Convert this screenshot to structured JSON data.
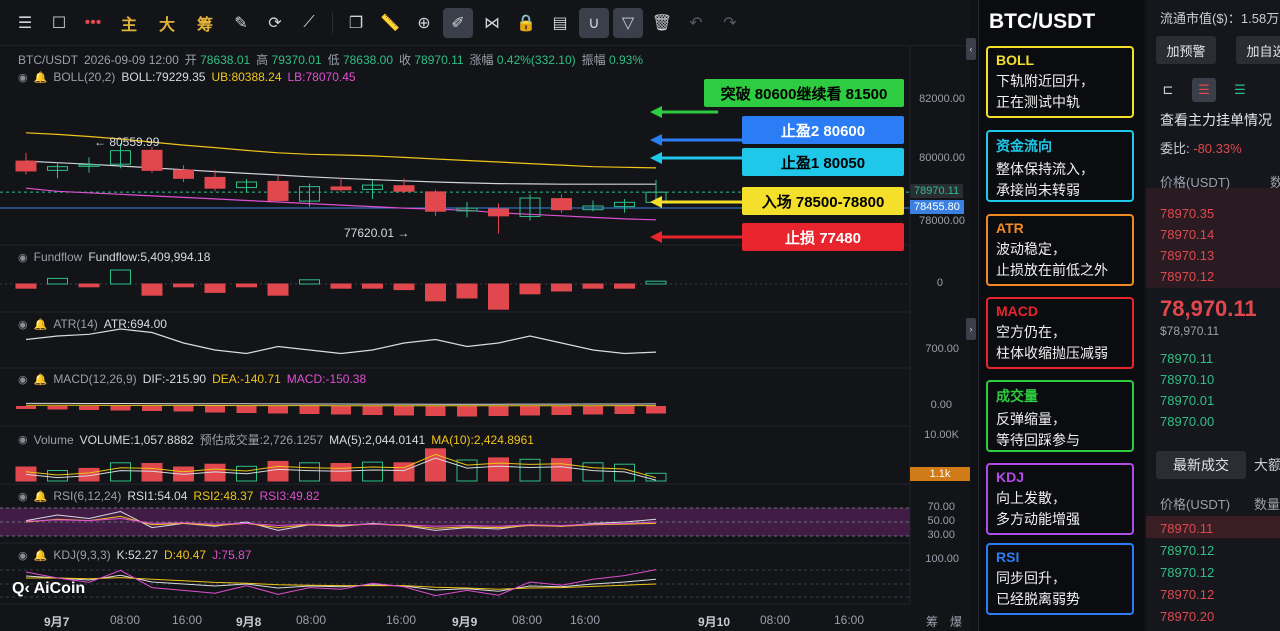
{
  "toolbar": {
    "text_buttons": [
      "主",
      "大",
      "筹"
    ]
  },
  "header": {
    "symbol": "BTC/USDT",
    "datetime": "2026-09-09 12:00",
    "open_label": "开",
    "open": "78638.01",
    "high_label": "高",
    "high": "79370.01",
    "low_label": "低",
    "low": "78638.00",
    "close_label": "收",
    "close": "78970.11",
    "change_label": "涨幅",
    "change": "0.42%(332.10)",
    "amp_label": "振幅",
    "amp": "0.93%"
  },
  "indicators": {
    "boll": {
      "name": "BOLL(20,2)",
      "mid": "BOLL:79229.35",
      "ub": "UB:80388.24",
      "lb": "LB:78070.45"
    },
    "fundflow": {
      "name": "Fundflow",
      "value": "Fundflow:5,409,994.18"
    },
    "atr": {
      "name": "ATR(14)",
      "value": "ATR:694.00"
    },
    "macd": {
      "name": "MACD(12,26,9)",
      "dif": "DIF:-215.90",
      "dea": "DEA:-140.71",
      "macd": "MACD:-150.38"
    },
    "volume": {
      "name": "Volume",
      "vol": "VOLUME:1,057.8882",
      "est": "预估成交量:2,726.1257",
      "ma5": "MA(5):2,044.0141",
      "ma10": "MA(10):2,424.8961"
    },
    "rsi": {
      "name": "RSI(6,12,24)",
      "rsi1": "RSI1:54.04",
      "rsi2": "RSI2:48.37",
      "rsi3": "RSI3:49.82"
    },
    "kdj": {
      "name": "KDJ(9,3,3)",
      "k": "K:52.27",
      "d": "D:40.47",
      "j": "J:75.87"
    }
  },
  "yaxis": {
    "price": [
      "82000.00",
      "80000.00",
      "78000.00"
    ],
    "fundflow": [
      "0"
    ],
    "atr": [
      "700.00"
    ],
    "macd": [
      "0.00"
    ],
    "volume": [
      "10.00K"
    ],
    "rsi": [
      "70.00",
      "50.00",
      "30.00"
    ],
    "kdj": [
      "100.00"
    ]
  },
  "price_tags": {
    "last": "78970.11",
    "line": "78455.80",
    "volume": "1.1k"
  },
  "chart_marks": {
    "high_mark": "← 80559.99",
    "low_mark": "77620.01 →"
  },
  "xaxis": [
    {
      "label": "9月7",
      "bold": true
    },
    {
      "label": "08:00",
      "bold": false
    },
    {
      "label": "16:00",
      "bold": false
    },
    {
      "label": "9月8",
      "bold": true
    },
    {
      "label": "08:00",
      "bold": false
    },
    {
      "label": "16:00",
      "bold": false
    },
    {
      "label": "9月9",
      "bold": true
    },
    {
      "label": "08:00",
      "bold": false
    },
    {
      "label": "16:00",
      "bold": false
    },
    {
      "label": "9月10",
      "bold": true
    },
    {
      "label": "08:00",
      "bold": false
    },
    {
      "label": "16:00",
      "bold": false
    }
  ],
  "xaxis_extra": {
    "chip": "筹",
    "burst": "爆"
  },
  "logo": "AiCoin",
  "annotations": [
    {
      "text": "突破 80600继续看 81500",
      "color": "#2ecc40"
    },
    {
      "text": "止盈2  80600",
      "color": "#2a7df4"
    },
    {
      "text": "止盈1  80050",
      "color": "#1fc8e8"
    },
    {
      "text": "入场  78500-78800",
      "color": "#f4e02a"
    },
    {
      "text": "止损  77480",
      "color": "#e8242c"
    }
  ],
  "panel": {
    "title": "BTC/USDT",
    "cards": [
      {
        "title": "BOLL",
        "desc": "下轨附近回升，\n正在测试中轨",
        "color": "#f4e02a"
      },
      {
        "title": "资金流向",
        "desc": "整体保持流入，\n承接尚未转弱",
        "color": "#1fc8e8"
      },
      {
        "title": "ATR",
        "desc": "波动稳定，\n止损放在前低之外",
        "color": "#f08a24"
      },
      {
        "title": "MACD",
        "desc": "空方仍在，\n柱体收缩抛压减弱",
        "color": "#e8242c"
      },
      {
        "title": "成交量",
        "desc": "反弹缩量，\n等待回踩参与",
        "color": "#2ecc40"
      },
      {
        "title": "KDJ",
        "desc": "向上发散，\n多方动能增强",
        "color": "#b14ce8"
      },
      {
        "title": "RSI",
        "desc": "同步回升，\n已经脱离弱势",
        "color": "#2a7df4"
      }
    ]
  },
  "book": {
    "market_cap": "流通市值($)：1.58万",
    "add_alert": "加预警",
    "add_watch": "加自选",
    "check_orders": "查看主力挂单情况",
    "ratio_label": "委比:",
    "ratio": "-80.33%",
    "price_head": "价格(USDT)",
    "qty_head": "数",
    "asks": [
      "78970.35",
      "78970.14",
      "78970.13",
      "78970.12"
    ],
    "last_price": "78,970.11",
    "last_usd": "$78,970.11",
    "bids": [
      "78970.11",
      "78970.10",
      "78970.01",
      "78970.00"
    ],
    "trades_tab": "最新成交",
    "big_tab": "大额",
    "trade_price_head": "价格(USDT)",
    "trade_qty_head": "数量",
    "trades": [
      {
        "price": "78970.11",
        "side": "sell"
      },
      {
        "price": "78970.12",
        "side": "buy"
      },
      {
        "price": "78970.12",
        "side": "buy"
      },
      {
        "price": "78970.12",
        "side": "sell"
      },
      {
        "price": "78970.20",
        "side": "sell"
      }
    ]
  },
  "chart_data": {
    "type": "candlestick",
    "symbol": "BTC/USDT",
    "candles": [
      {
        "o": 79980,
        "h": 80250,
        "l": 79550,
        "c": 79660
      },
      {
        "o": 79680,
        "h": 79950,
        "l": 79420,
        "c": 79800
      },
      {
        "o": 79810,
        "h": 80100,
        "l": 79600,
        "c": 79860
      },
      {
        "o": 79880,
        "h": 80560,
        "l": 79750,
        "c": 80320
      },
      {
        "o": 80330,
        "h": 80450,
        "l": 79600,
        "c": 79680
      },
      {
        "o": 79690,
        "h": 79850,
        "l": 79300,
        "c": 79420
      },
      {
        "o": 79450,
        "h": 79700,
        "l": 79000,
        "c": 79100
      },
      {
        "o": 79120,
        "h": 79400,
        "l": 78950,
        "c": 79300
      },
      {
        "o": 79320,
        "h": 79520,
        "l": 78620,
        "c": 78700
      },
      {
        "o": 78680,
        "h": 79250,
        "l": 78500,
        "c": 79150
      },
      {
        "o": 79140,
        "h": 79420,
        "l": 78980,
        "c": 79050
      },
      {
        "o": 79060,
        "h": 79350,
        "l": 78750,
        "c": 79200
      },
      {
        "o": 79180,
        "h": 79420,
        "l": 78950,
        "c": 79000
      },
      {
        "o": 78980,
        "h": 79050,
        "l": 78200,
        "c": 78350
      },
      {
        "o": 78360,
        "h": 78650,
        "l": 78150,
        "c": 78450
      },
      {
        "o": 78420,
        "h": 78600,
        "l": 77620,
        "c": 78200
      },
      {
        "o": 78180,
        "h": 78900,
        "l": 78050,
        "c": 78780
      },
      {
        "o": 78760,
        "h": 78900,
        "l": 78300,
        "c": 78400
      },
      {
        "o": 78400,
        "h": 78700,
        "l": 78350,
        "c": 78520
      },
      {
        "o": 78500,
        "h": 78750,
        "l": 78300,
        "c": 78640
      },
      {
        "o": 78638,
        "h": 79370,
        "l": 78638,
        "c": 78970
      }
    ],
    "boll_ub": [
      80900,
      80850,
      80780,
      80700,
      80600,
      80500,
      80420,
      80330,
      80250,
      80200,
      80180,
      80150,
      80100,
      80050,
      80000,
      79950,
      79900,
      79850,
      79800,
      79780,
      79760
    ],
    "boll_mid": [
      79980,
      79930,
      79880,
      79820,
      79760,
      79700,
      79640,
      79580,
      79530,
      79470,
      79420,
      79380,
      79340,
      79300,
      79270,
      79250,
      79240,
      79230,
      79230,
      79229,
      79229
    ],
    "boll_lb": [
      79100,
      79000,
      78950,
      78900,
      78850,
      78800,
      78750,
      78700,
      78650,
      78600,
      78550,
      78500,
      78450,
      78420,
      78380,
      78300,
      78250,
      78200,
      78150,
      78100,
      78070
    ],
    "fundflow": [
      -0.3,
      0.4,
      -0.2,
      1.0,
      -0.8,
      -0.2,
      -0.6,
      -0.2,
      -0.8,
      0.3,
      -0.3,
      -0.3,
      -0.4,
      -1.2,
      -1.0,
      -1.8,
      -0.7,
      -0.5,
      -0.3,
      -0.3,
      0.2
    ],
    "atr": [
      730,
      740,
      745,
      760,
      750,
      720,
      700,
      690,
      710,
      700,
      690,
      700,
      720,
      730,
      710,
      720,
      740,
      720,
      700,
      690,
      694
    ],
    "macd_hist": [
      -60,
      -70,
      -80,
      -90,
      -100,
      -110,
      -130,
      -140,
      -150,
      -160,
      -170,
      -180,
      -190,
      -200,
      -210,
      -200,
      -190,
      -180,
      -170,
      -160,
      -150
    ],
    "volume": [
      2.0,
      1.5,
      1.8,
      2.6,
      2.5,
      2.0,
      2.4,
      2.1,
      2.8,
      2.6,
      2.5,
      2.7,
      2.6,
      4.6,
      3.0,
      3.3,
      3.1,
      3.2,
      2.6,
      2.4,
      1.1
    ],
    "vol_up": [
      false,
      true,
      false,
      true,
      false,
      false,
      false,
      true,
      false,
      true,
      false,
      true,
      false,
      false,
      true,
      false,
      true,
      false,
      true,
      true,
      true
    ],
    "rsi1": [
      52,
      60,
      55,
      65,
      42,
      48,
      44,
      50,
      38,
      46,
      44,
      48,
      45,
      38,
      42,
      40,
      46,
      44,
      48,
      50,
      54
    ],
    "rsi2": [
      50,
      54,
      52,
      58,
      46,
      48,
      45,
      48,
      42,
      46,
      45,
      47,
      45,
      41,
      43,
      42,
      45,
      44,
      46,
      47,
      48
    ],
    "rsi3": [
      51,
      53,
      52,
      55,
      48,
      49,
      47,
      48,
      45,
      47,
      46,
      47,
      46,
      44,
      45,
      44,
      46,
      45,
      47,
      48,
      50
    ],
    "kdj_k": [
      60,
      55,
      50,
      62,
      45,
      40,
      35,
      40,
      30,
      35,
      33,
      38,
      35,
      25,
      28,
      22,
      35,
      33,
      40,
      45,
      52
    ],
    "kdj_d": [
      55,
      55,
      53,
      56,
      52,
      48,
      44,
      42,
      38,
      37,
      36,
      36,
      36,
      32,
      30,
      27,
      30,
      31,
      34,
      37,
      40
    ],
    "kdj_j": [
      70,
      55,
      44,
      74,
      31,
      24,
      17,
      36,
      14,
      31,
      27,
      42,
      33,
      11,
      24,
      12,
      45,
      37,
      52,
      61,
      76
    ]
  }
}
